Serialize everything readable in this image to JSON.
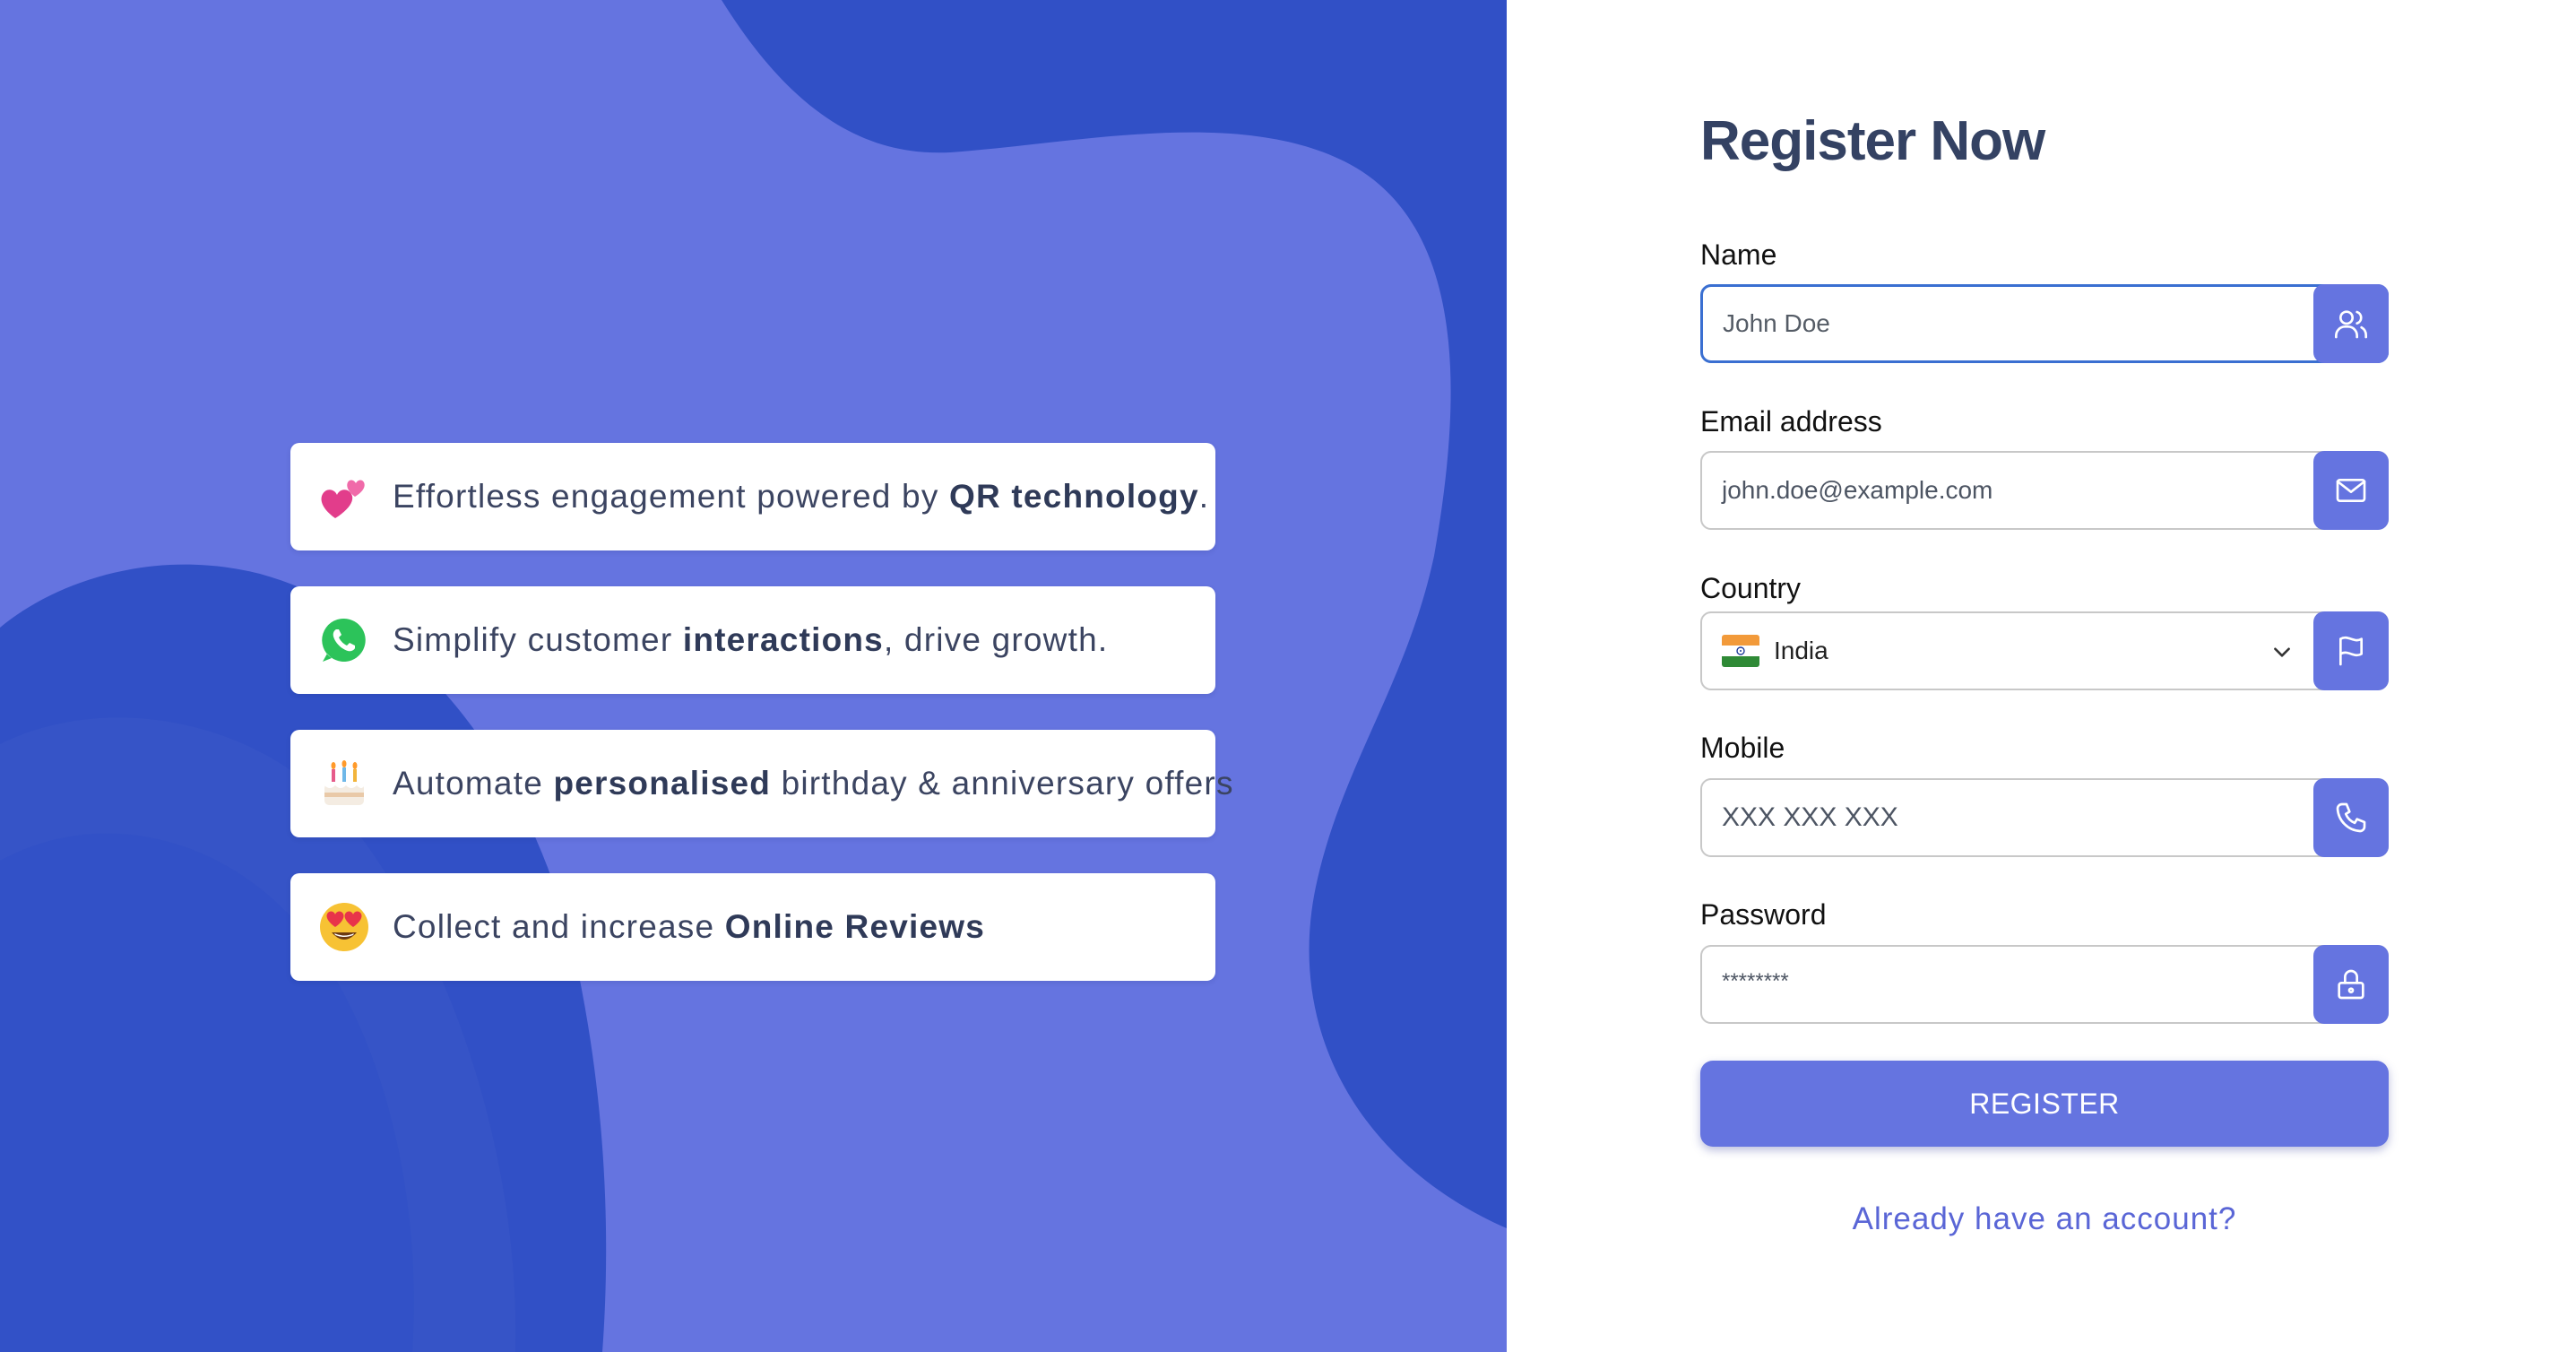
{
  "theme": {
    "accent": "#6574e0",
    "accent_dark": "#3150c6",
    "text_dark": "#344263",
    "focus_border": "#3a6fd1"
  },
  "features": [
    {
      "icon": "two-hearts-emoji",
      "parts": [
        "Effortless engagement powered by ",
        "QR technology",
        "."
      ]
    },
    {
      "icon": "whatsapp-icon",
      "parts": [
        "Simplify customer ",
        "interactions",
        ", drive growth."
      ]
    },
    {
      "icon": "birthday-cake-emoji",
      "parts": [
        "Automate ",
        "personalised",
        " birthday & anniversary offers"
      ]
    },
    {
      "icon": "heart-eyes-emoji",
      "parts": [
        "Collect and increase ",
        "Online Reviews",
        ""
      ]
    }
  ],
  "form": {
    "title": "Register Now",
    "name": {
      "label": "Name",
      "value": "John Doe",
      "icon": "users-icon"
    },
    "email": {
      "label": "Email address",
      "placeholder": "john.doe@example.com",
      "icon": "mail-icon"
    },
    "country": {
      "label": "Country",
      "value": "India",
      "flag": "india-flag-icon",
      "icon": "flag-icon"
    },
    "mobile": {
      "label": "Mobile",
      "placeholder": "XXX XXX XXX",
      "icon": "phone-icon"
    },
    "password": {
      "label": "Password",
      "placeholder": "********",
      "icon": "lock-icon"
    },
    "submit_label": "REGISTER",
    "login_link": "Already have an account?"
  }
}
